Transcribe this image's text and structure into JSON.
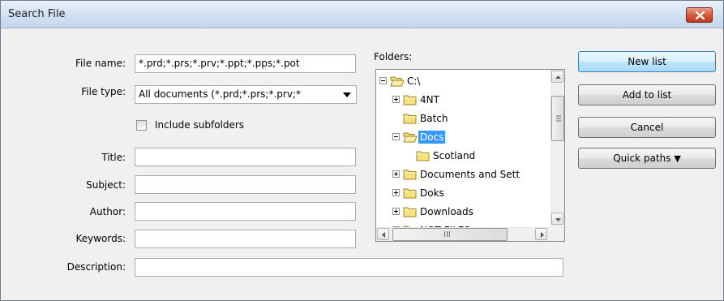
{
  "window": {
    "title": "Search File"
  },
  "form": {
    "file_name_label": "File name:",
    "file_name_value": "*.prd;*.prs;*.prv;*.ppt;*.pps;*.pot",
    "file_type_label": "File type:",
    "file_type_value": "All documents (*.prd;*.prs;*.prv;*",
    "include_subfolders_label": "Include subfolders",
    "include_subfolders_checked": false,
    "title_label": "Title:",
    "title_value": "",
    "subject_label": "Subject:",
    "subject_value": "",
    "author_label": "Author:",
    "author_value": "",
    "keywords_label": "Keywords:",
    "keywords_value": "",
    "description_label": "Description:",
    "description_value": ""
  },
  "folders": {
    "label": "Folders:",
    "items": [
      {
        "label": "C:\\",
        "expander": "minus",
        "icon": "open-folder-icon"
      },
      {
        "label": "4NT",
        "expander": "plus",
        "icon": "folder-icon"
      },
      {
        "label": "Batch",
        "expander": "none",
        "icon": "folder-icon"
      },
      {
        "label": "Docs",
        "expander": "minus",
        "icon": "open-folder-icon",
        "selected": true
      },
      {
        "label": "Scotland",
        "expander": "none",
        "icon": "folder-icon"
      },
      {
        "label": "Documents and Sett",
        "expander": "plus",
        "icon": "folder-icon"
      },
      {
        "label": "Doks",
        "expander": "plus",
        "icon": "folder-icon"
      },
      {
        "label": "Downloads",
        "expander": "plus",
        "icon": "folder-icon"
      },
      {
        "label": "NOT FILES",
        "expander": "plus",
        "icon": "folder-icon"
      }
    ],
    "hscroll_grip": "III"
  },
  "buttons": {
    "new_list": "New list",
    "add_to_list": "Add to list",
    "cancel": "Cancel",
    "quick_paths": "Quick paths",
    "quick_paths_arrow": "▼"
  },
  "colors": {
    "selection": "#3399ff",
    "close_button": "#d5593f",
    "folder": "#f5e27a"
  }
}
